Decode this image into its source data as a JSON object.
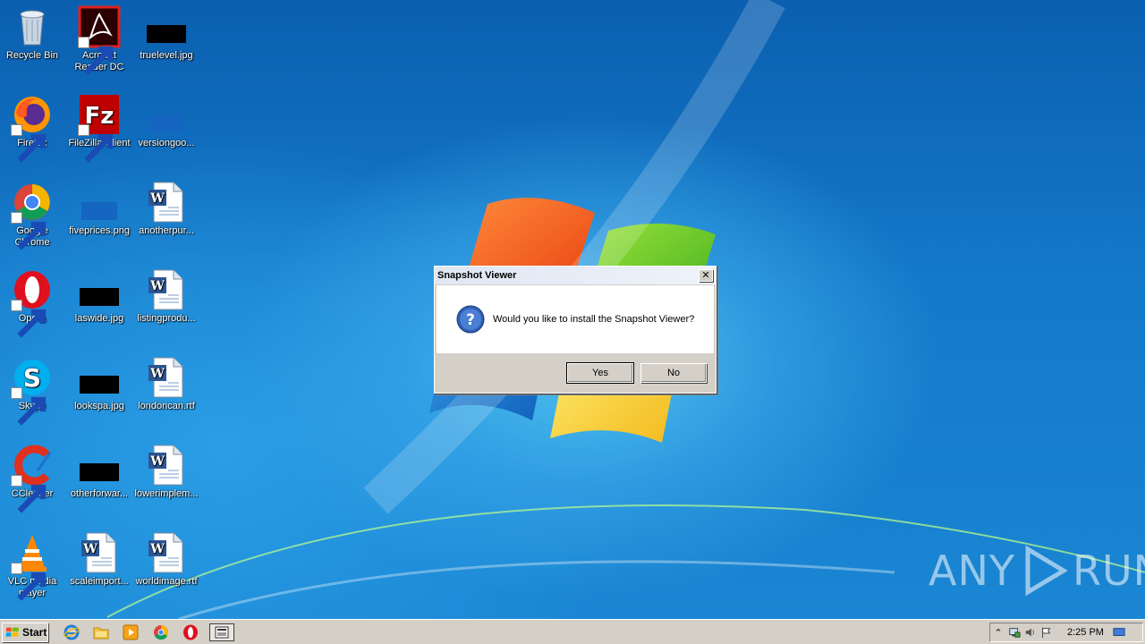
{
  "desktop": {
    "icons": [
      {
        "label": "Recycle Bin",
        "icon": "recycle-bin-icon"
      },
      {
        "label": "Acrobat Reader DC",
        "icon": "acrobat-icon"
      },
      {
        "label": "truelevel.jpg",
        "icon": "image-file-icon"
      },
      {
        "label": "Firefox",
        "icon": "firefox-icon"
      },
      {
        "label": "FileZilla Client",
        "icon": "filezilla-icon"
      },
      {
        "label": "versiongoo...",
        "icon": "image-file-icon"
      },
      {
        "label": "Google Chrome",
        "icon": "chrome-icon"
      },
      {
        "label": "fiveprices.png",
        "icon": "image-file-icon"
      },
      {
        "label": "anotherpur...",
        "icon": "word-document-icon"
      },
      {
        "label": "Opera",
        "icon": "opera-icon"
      },
      {
        "label": "laswide.jpg",
        "icon": "image-file-icon"
      },
      {
        "label": "listingprodu...",
        "icon": "word-document-icon"
      },
      {
        "label": "Skype",
        "icon": "skype-icon"
      },
      {
        "label": "lookspa.jpg",
        "icon": "image-file-icon"
      },
      {
        "label": "londoncan.rtf",
        "icon": "word-document-icon"
      },
      {
        "label": "CCleaner",
        "icon": "ccleaner-icon"
      },
      {
        "label": "otherforwar...",
        "icon": "image-file-icon"
      },
      {
        "label": "lowerimplem...",
        "icon": "word-document-icon"
      },
      {
        "label": "VLC media player",
        "icon": "vlc-icon"
      },
      {
        "label": "scaleimport...",
        "icon": "word-document-icon"
      },
      {
        "label": "worldimage.rtf",
        "icon": "word-document-icon"
      }
    ]
  },
  "dialog": {
    "title": "Snapshot Viewer",
    "message": "Would you like to install the Snapshot Viewer?",
    "yes_label": "Yes",
    "no_label": "No",
    "icon": "question-icon"
  },
  "taskbar": {
    "start_label": "Start",
    "clock": "2:25 PM"
  },
  "watermark": {
    "left": "ANY",
    "right": "RUN"
  }
}
